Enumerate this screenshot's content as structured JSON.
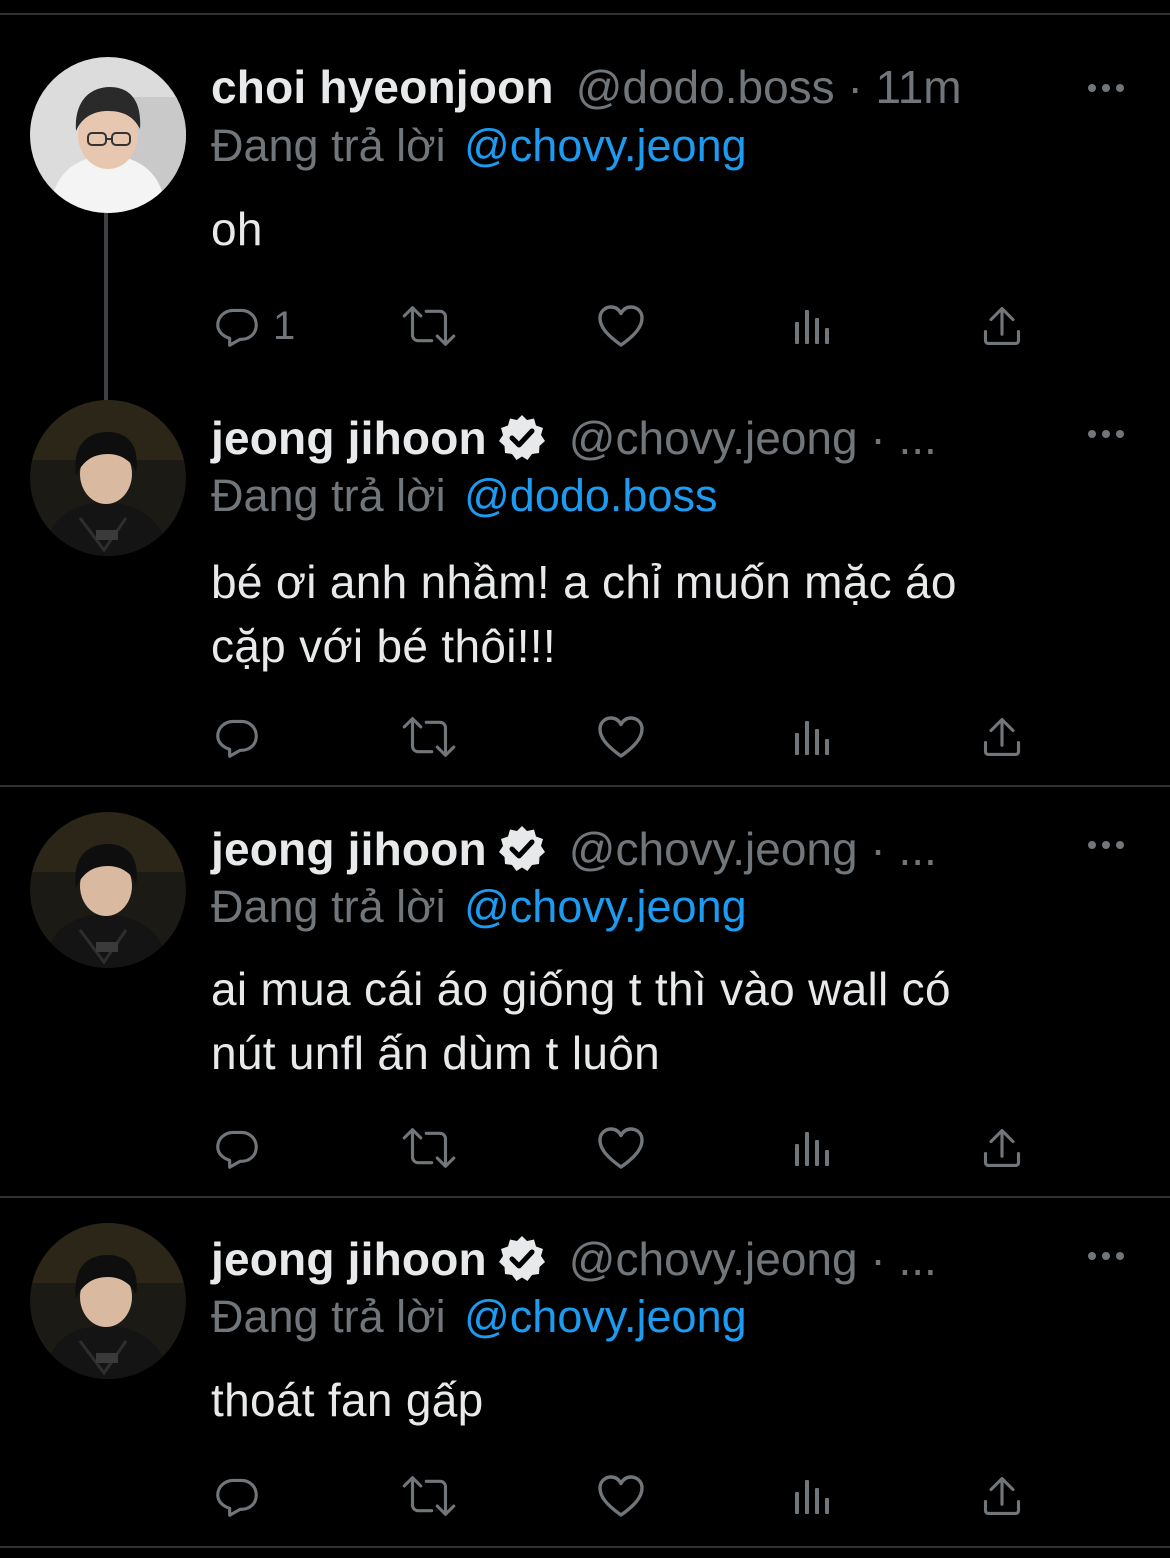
{
  "colors": {
    "background": "#000000",
    "text": "#e7e9ea",
    "muted": "#71767b",
    "link": "#1d9bf0",
    "divider": "#2f3336"
  },
  "tweets": [
    {
      "display_name": "choi hyeonjoon",
      "meta": "@dodo.boss · 11m",
      "verified": false,
      "replying_prefix": "Đang trả lời",
      "replying_to": "@chovy.jeong",
      "text_lines": [
        "oh"
      ],
      "reply_count": "1",
      "avatar": "avatar-photo-white-shirt",
      "actions": [
        "reply-icon",
        "retweet-icon",
        "like-icon",
        "views-icon",
        "share-icon"
      ]
    },
    {
      "display_name": "jeong jihoon",
      "meta": "@chovy.jeong · ...",
      "verified": true,
      "replying_prefix": "Đang trả lời",
      "replying_to": "@dodo.boss",
      "text_lines": [
        "bé ơi anh nhầm! a chỉ muốn mặc áo",
        "cặp với bé thôi!!!"
      ],
      "reply_count": "",
      "avatar": "avatar-photo-dark-jersey",
      "actions": [
        "reply-icon",
        "retweet-icon",
        "like-icon",
        "views-icon",
        "share-icon"
      ]
    },
    {
      "display_name": "jeong jihoon",
      "meta": "@chovy.jeong · ...",
      "verified": true,
      "replying_prefix": "Đang trả lời",
      "replying_to": "@chovy.jeong",
      "text_lines": [
        "ai mua cái áo giống t thì vào wall có",
        "nút unfl ấn dùm t luôn"
      ],
      "reply_count": "",
      "avatar": "avatar-photo-dark-jersey",
      "actions": [
        "reply-icon",
        "retweet-icon",
        "like-icon",
        "views-icon",
        "share-icon"
      ]
    },
    {
      "display_name": "jeong jihoon",
      "meta": "@chovy.jeong · ...",
      "verified": true,
      "replying_prefix": "Đang trả lời",
      "replying_to": "@chovy.jeong",
      "text_lines": [
        "thoát fan gấp"
      ],
      "reply_count": "",
      "avatar": "avatar-photo-dark-jersey",
      "actions": [
        "reply-icon",
        "retweet-icon",
        "like-icon",
        "views-icon",
        "share-icon"
      ]
    }
  ]
}
